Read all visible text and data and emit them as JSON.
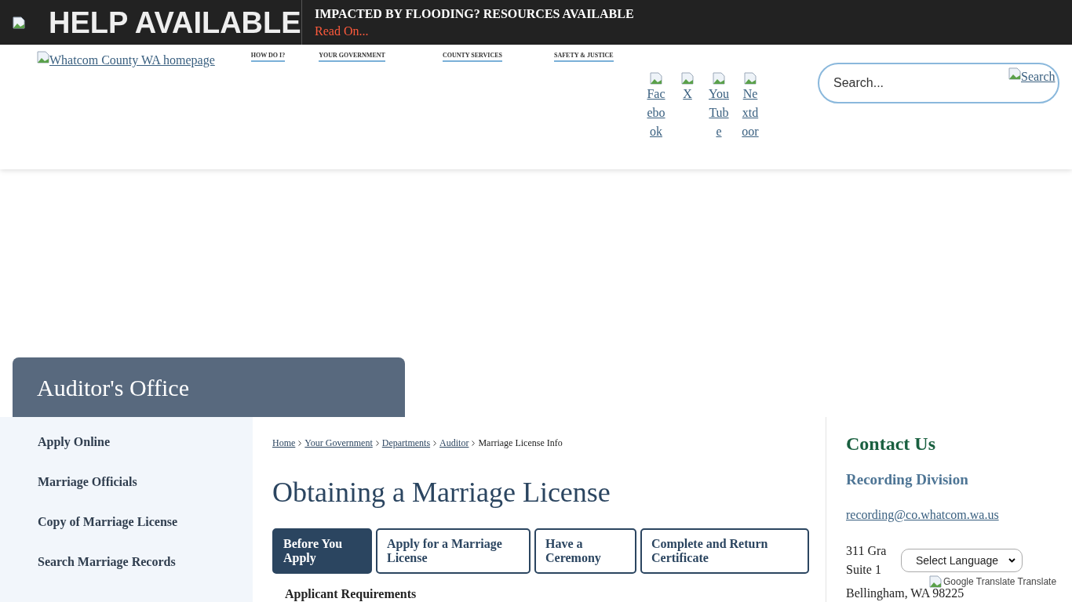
{
  "alert_bar": {
    "title": "HELP AVAILABLE",
    "headline": "IMPACTED BY FLOODING? RESOURCES AVAILABLE",
    "link": "Read On..."
  },
  "header": {
    "logo_alt": "Whatcom County WA homepage",
    "nav": [
      "HOW DO I?",
      "YOUR GOVERNMENT",
      "COUNTY SERVICES",
      "SAFETY & JUSTICE"
    ],
    "social": [
      "Facebook",
      "X",
      "YouTube",
      "Nextdoor"
    ],
    "search": {
      "placeholder": "Search...",
      "button": "Search"
    }
  },
  "department": {
    "title": "Auditor's Office"
  },
  "sidebar": {
    "items": [
      "Apply Online",
      "Marriage Officials",
      "Copy of Marriage License",
      "Search Marriage Records"
    ]
  },
  "breadcrumb": {
    "links": [
      "Home",
      "Your Government",
      "Departments",
      "Auditor"
    ],
    "current": "Marriage License Info"
  },
  "page_title": "Obtaining a Marriage License",
  "tabs": [
    {
      "label": "Before You Apply",
      "selected": true
    },
    {
      "label": "Apply for a Marriage License",
      "selected": false
    },
    {
      "label": "Have a Ceremony",
      "selected": false
    },
    {
      "label": "Complete and Return Certificate",
      "selected": false
    }
  ],
  "section_heading": "Applicant Requirements",
  "contact": {
    "title": "Contact Us",
    "division": "Recording Division",
    "email": "recording@co.whatcom.wa.us",
    "address": [
      "311 Gra",
      "Suite 1",
      "Bellingham, WA 98225"
    ]
  },
  "translate": {
    "select": "Select Language",
    "label": "Google Translate Translate"
  }
}
